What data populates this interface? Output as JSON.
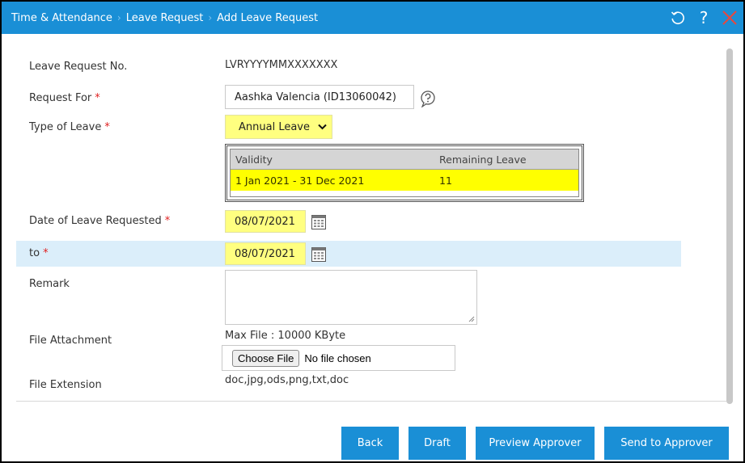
{
  "breadcrumb": {
    "items": [
      "Time & Attendance",
      "Leave Request",
      "Add Leave Request"
    ],
    "separator": "›"
  },
  "toolbar": {
    "refresh_icon": "refresh-icon",
    "help_label": "?",
    "close_icon": "close-icon"
  },
  "form": {
    "request_no": {
      "label": "Leave Request No.",
      "value": "LVRYYYYMMXXXXXXX"
    },
    "request_for": {
      "label": "Request For",
      "required_mark": "*",
      "value": "Aashka Valencia (ID13060042)"
    },
    "leave_type": {
      "label": "Type of Leave",
      "required_mark": "*",
      "value": "Annual Leave"
    },
    "leave_table": {
      "columns": [
        "Validity",
        "Remaining Leave"
      ],
      "rows": [
        {
          "validity": "1 Jan 2021 - 31 Dec 2021",
          "remaining": "11"
        }
      ]
    },
    "date_from": {
      "label": "Date of Leave Requested",
      "required_mark": "*",
      "value": "08/07/2021"
    },
    "date_to": {
      "label": "to",
      "required_mark": "*",
      "value": "08/07/2021"
    },
    "remark": {
      "label": "Remark",
      "value": ""
    },
    "attachment": {
      "label": "File Attachment",
      "max_file": "Max File : 10000 KByte",
      "choose_label": "Choose File",
      "no_file": "No file chosen"
    },
    "extension": {
      "label": "File Extension",
      "value": "doc,jpg,ods,png,txt,doc"
    }
  },
  "actions": {
    "back": "Back",
    "draft": "Draft",
    "preview": "Preview Approver",
    "send": "Send to Approver"
  },
  "colors": {
    "header_blue": "#1a8fd6",
    "required_red": "#e02020",
    "highlight_yellow": "#ffff00",
    "field_yellow": "#ffff80",
    "row_highlight": "#dbeefa",
    "close_red": "#e8473e"
  }
}
